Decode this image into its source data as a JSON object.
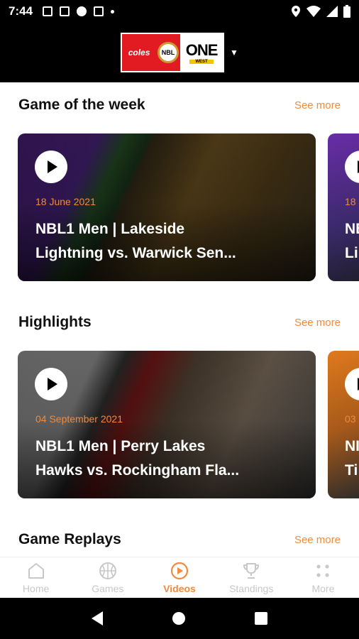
{
  "status_bar": {
    "time": "7:44"
  },
  "header": {
    "logo_left": "coles",
    "logo_nbl": "NBL",
    "logo_one": "ONE",
    "logo_west": "WEST"
  },
  "sections": [
    {
      "title": "Game of the week",
      "see_more": "See more",
      "card": {
        "date": "18 June 2021",
        "title": "NBL1 Men | Lakeside\nLightning vs. Warwick Sen..."
      },
      "peek": {
        "date": "18 J",
        "title": "NB\nLi"
      }
    },
    {
      "title": "Highlights",
      "see_more": "See more",
      "card": {
        "date": "04 September 2021",
        "title": "NBL1 Men | Perry Lakes\nHawks vs. Rockingham Fla..."
      },
      "peek": {
        "date": "03",
        "title": "NI\nTi"
      }
    },
    {
      "title": "Game Replays",
      "see_more": "See more"
    }
  ],
  "bottom_nav": [
    {
      "label": "Home",
      "icon": "home-icon",
      "active": false
    },
    {
      "label": "Games",
      "icon": "basketball-icon",
      "active": false
    },
    {
      "label": "Videos",
      "icon": "play-circle-icon",
      "active": true
    },
    {
      "label": "Standings",
      "icon": "trophy-icon",
      "active": false
    },
    {
      "label": "More",
      "icon": "grid-dots-icon",
      "active": false
    }
  ],
  "colors": {
    "accent": "#f08a3c",
    "inactive": "#c8c8c8"
  }
}
